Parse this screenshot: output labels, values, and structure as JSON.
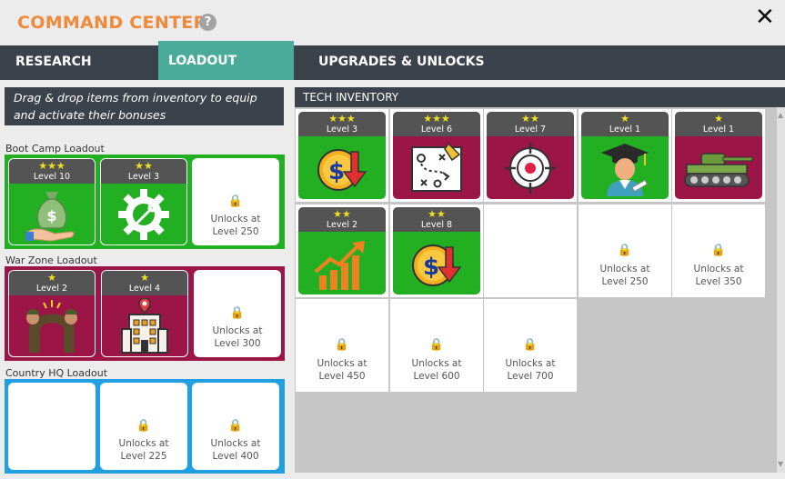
{
  "header": {
    "title": "COMMAND CENTER",
    "help_glyph": "?",
    "close_glyph": "✕"
  },
  "tabs": [
    {
      "label": "RESEARCH",
      "active": false
    },
    {
      "label": "LOADOUT",
      "active": true
    },
    {
      "label": "UPGRADES & UNLOCKS",
      "active": false
    }
  ],
  "info_text": "Drag & drop items from inventory to equip and activate their bonuses",
  "lock_glyph": "🔒",
  "loadouts": {
    "boot_camp": {
      "label": "Boot Camp Loadout",
      "color": "#22b022",
      "slots": [
        {
          "stars": "★★★",
          "level": "Level 10",
          "icon": "money-bag-icon"
        },
        {
          "stars": "★★",
          "level": "Level 3",
          "icon": "gear-wrench-icon"
        },
        {
          "unlock_line1": "Unlocks at",
          "unlock_line2": "Level 250"
        }
      ]
    },
    "war_zone": {
      "label": "War Zone Loadout",
      "color": "#9c1547",
      "slots": [
        {
          "stars": "★",
          "level": "Level 2",
          "icon": "soldiers-arch-icon"
        },
        {
          "stars": "★",
          "level": "Level 4",
          "icon": "hq-building-icon"
        },
        {
          "unlock_line1": "Unlocks at",
          "unlock_line2": "Level 300"
        }
      ]
    },
    "country_hq": {
      "label": "Country HQ Loadout",
      "color": "#20a0e0",
      "slots": [
        {
          "empty": true
        },
        {
          "unlock_line1": "Unlocks at",
          "unlock_line2": "Level 225"
        },
        {
          "unlock_line1": "Unlocks at",
          "unlock_line2": "Level 400"
        }
      ]
    }
  },
  "inventory": {
    "header": "TECH INVENTORY",
    "items": [
      {
        "stars": "★★★",
        "level": "Level 3",
        "icon": "dollar-down-icon",
        "color": "#22b022"
      },
      {
        "stars": "★★★",
        "level": "Level 6",
        "icon": "strategy-map-icon",
        "color": "#9c1547"
      },
      {
        "stars": "★★",
        "level": "Level 7",
        "icon": "target-icon",
        "color": "#9c1547"
      },
      {
        "stars": "★",
        "level": "Level 1",
        "icon": "graduate-icon",
        "color": "#22b022"
      },
      {
        "stars": "★",
        "level": "Level 1",
        "icon": "tank-icon",
        "color": "#9c1547"
      },
      {
        "stars": "★★",
        "level": "Level 2",
        "icon": "growth-chart-icon",
        "color": "#22b022"
      },
      {
        "stars": "★★",
        "level": "Level 8",
        "icon": "dollar-down-icon",
        "color": "#22b022"
      }
    ],
    "locked": [
      {
        "unlock_line1": "Unlocks at",
        "unlock_line2": "Level 250"
      },
      {
        "unlock_line1": "Unlocks at",
        "unlock_line2": "Level 350"
      },
      {
        "unlock_line1": "Unlocks at",
        "unlock_line2": "Level 450"
      },
      {
        "unlock_line1": "Unlocks at",
        "unlock_line2": "Level 600"
      },
      {
        "unlock_line1": "Unlocks at",
        "unlock_line2": "Level 700"
      }
    ]
  }
}
